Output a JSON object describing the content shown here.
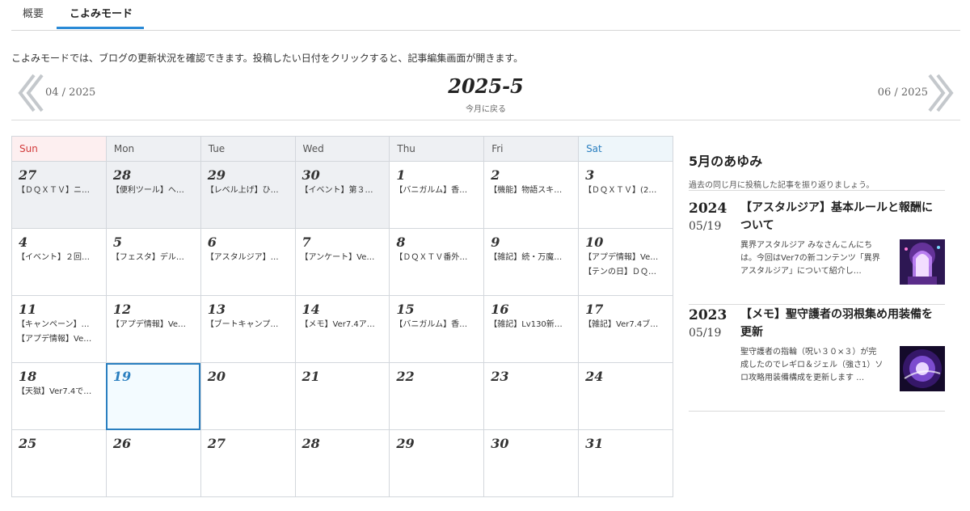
{
  "tabs": [
    "概要",
    "こよみモード"
  ],
  "description": "こよみモードでは、ブログの更新状況を確認できます。投稿したい日付をクリックすると、記事編集画面が開きます。",
  "nav": {
    "prev": "04 / 2025",
    "title": "2025-5",
    "subtitle": "今月に戻る",
    "next": "06 / 2025"
  },
  "weekdays": [
    "Sun",
    "Mon",
    "Tue",
    "Wed",
    "Thu",
    "Fri",
    "Sat"
  ],
  "weeks": [
    [
      {
        "day": "27",
        "prev": true,
        "posts": [
          "【ＤＱＸＴＶ】ニ…"
        ]
      },
      {
        "day": "28",
        "prev": true,
        "posts": [
          "【便利ツール】ヘ…"
        ]
      },
      {
        "day": "29",
        "prev": true,
        "posts": [
          "【レベル上げ】ひ…"
        ]
      },
      {
        "day": "30",
        "prev": true,
        "posts": [
          "【イベント】第３…"
        ]
      },
      {
        "day": "1",
        "posts": [
          "【バニガルム】香…"
        ]
      },
      {
        "day": "2",
        "posts": [
          "【機能】物語スキ…"
        ]
      },
      {
        "day": "3",
        "posts": [
          "【ＤＱＸＴＶ】(2…"
        ]
      }
    ],
    [
      {
        "day": "4",
        "posts": [
          "【イベント】２回…"
        ]
      },
      {
        "day": "5",
        "posts": [
          "【フェスタ】デル…"
        ]
      },
      {
        "day": "6",
        "posts": [
          "【アスタルジア】…"
        ]
      },
      {
        "day": "7",
        "posts": [
          "【アンケート】Ve…"
        ]
      },
      {
        "day": "8",
        "posts": [
          "【ＤＱＸＴＶ番外…"
        ]
      },
      {
        "day": "9",
        "posts": [
          "【雑記】続・万魔…"
        ]
      },
      {
        "day": "10",
        "posts": [
          "【アプデ情報】Ve…",
          "【テンの日】ＤＱ…"
        ]
      }
    ],
    [
      {
        "day": "11",
        "posts": [
          "【キャンペーン】…",
          "【アプデ情報】Ve…"
        ]
      },
      {
        "day": "12",
        "posts": [
          "【アプデ情報】Ve…"
        ]
      },
      {
        "day": "13",
        "posts": [
          "【ブートキャンプ…"
        ]
      },
      {
        "day": "14",
        "posts": [
          "【メモ】Ver7.4ア…"
        ]
      },
      {
        "day": "15",
        "posts": [
          "【バニガルム】香…"
        ]
      },
      {
        "day": "16",
        "posts": [
          "【雑記】Lv130新…"
        ]
      },
      {
        "day": "17",
        "posts": [
          "【雑記】Ver7.4ブ…"
        ]
      }
    ],
    [
      {
        "day": "18",
        "posts": [
          "【天獄】Ver7.4で…"
        ]
      },
      {
        "day": "19",
        "today": true,
        "posts": []
      },
      {
        "day": "20",
        "posts": []
      },
      {
        "day": "21",
        "posts": []
      },
      {
        "day": "22",
        "posts": []
      },
      {
        "day": "23",
        "posts": []
      },
      {
        "day": "24",
        "posts": []
      }
    ],
    [
      {
        "day": "25",
        "posts": []
      },
      {
        "day": "26",
        "posts": []
      },
      {
        "day": "27",
        "posts": []
      },
      {
        "day": "28",
        "posts": []
      },
      {
        "day": "29",
        "posts": []
      },
      {
        "day": "30",
        "posts": []
      },
      {
        "day": "31",
        "posts": []
      }
    ]
  ],
  "sidebar": {
    "title": "5月のあゆみ",
    "subtitle": "過去の同じ月に投稿した記事を振り返りましょう。",
    "entries": [
      {
        "year": "2024",
        "date": "05/19",
        "title": "【アスタルジア】基本ルールと報酬について",
        "excerpt": "異界アスタルジア みなさんこんにちは。今回はVer7の新コンテンツ「異界アスタルジア」について紹介し…",
        "thumb": "purple-gate-thumbnail"
      },
      {
        "year": "2023",
        "date": "05/19",
        "title": "【メモ】聖守護者の羽根集め用装備を更新",
        "excerpt": "聖守護者の指輪（呪い３０×３）が完成したのでレギロ＆ジェル（強さ1）ソロ攻略用装備構成を更新します …",
        "thumb": "purple-orb-thumbnail"
      }
    ]
  },
  "colors": {
    "accent": "#2a7fc0",
    "sunday": "#d23a3a",
    "saturday": "#2a7fc0",
    "prev_month_bg": "#eef0f3"
  }
}
